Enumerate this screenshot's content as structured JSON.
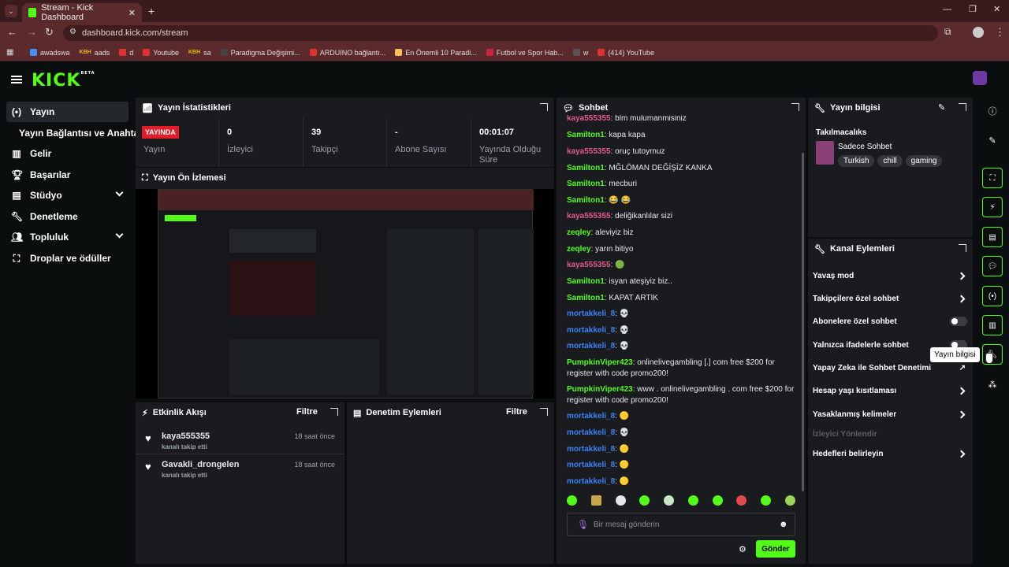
{
  "browser": {
    "tab_title": "Stream - Kick Dashboard",
    "url": "dashboard.kick.com/stream",
    "bookmarks": [
      {
        "label": "awadswa",
        "color": "#4a8df6"
      },
      {
        "label": "aads",
        "color": "#e9b800"
      },
      {
        "label": "d",
        "color": "#e03131"
      },
      {
        "label": "Youtube",
        "color": "#e03131"
      },
      {
        "label": "sa",
        "color": "#e9b800"
      },
      {
        "label": "Paradigma Değişimi...",
        "color": "#444"
      },
      {
        "label": "ARDUINO bağlantı...",
        "color": "#e03131"
      },
      {
        "label": "En Önemli 10 Paradi...",
        "color": "#f4c15a"
      },
      {
        "label": "Futbol ve Spor Hab...",
        "color": "#c24"
      },
      {
        "label": "w",
        "color": "#555"
      },
      {
        "label": "(414) YouTube",
        "color": "#e03131"
      }
    ],
    "bookmark_prefix": "KBH"
  },
  "brand": {
    "logo": "KICK",
    "beta": "BETA",
    "accent": "#53fc18"
  },
  "sidebar": {
    "items": [
      {
        "label": "Yayın",
        "icon": "broadcast-icon"
      },
      {
        "label": "Yayın Bağlantısı ve Anahtarı",
        "icon": ""
      },
      {
        "label": "Gelir",
        "icon": "revenue-icon"
      },
      {
        "label": "Başarılar",
        "icon": "trophy-icon"
      },
      {
        "label": "Stüdyo",
        "icon": "studio-icon"
      },
      {
        "label": "Denetleme",
        "icon": "wrench-icon"
      },
      {
        "label": "Topluluk",
        "icon": "community-icon"
      },
      {
        "label": "Droplar ve ödüller",
        "icon": "gift-icon"
      }
    ]
  },
  "stats": {
    "title": "Yayın İstatistikleri",
    "live_badge": "YAYINDA",
    "live_label": "Yayın",
    "viewers_value": "0",
    "viewers_label": "İzleyici",
    "followers_value": "39",
    "followers_label": "Takipçi",
    "subs_value": "-",
    "subs_label": "Abone Sayısı",
    "uptime_value": "00:01:07",
    "uptime_label": "Yayında Olduğu Süre"
  },
  "preview": {
    "title": "Yayın Ön İzlemesi"
  },
  "activity": {
    "title": "Etkinlik Akışı",
    "filter": "Filtre",
    "items": [
      {
        "user": "kaya555355",
        "action": "kanalı takip etti",
        "time": "18 saat önce"
      },
      {
        "user": "Gavakli_drongelen",
        "action": "kanalı takip etti",
        "time": "18 saat önce"
      }
    ]
  },
  "moderation": {
    "title": "Denetim Eylemleri",
    "filter": "Filtre"
  },
  "chat": {
    "title": "Sohbet",
    "messages": [
      {
        "user": "kaya555355",
        "color": "p",
        "text": ": blm mulumanmisiniz"
      },
      {
        "user": "Samilton1",
        "color": "g",
        "text": ": kapa kapa"
      },
      {
        "user": "kaya555355",
        "color": "p",
        "text": ": oruç tutoyrnuz"
      },
      {
        "user": "Samilton1",
        "color": "g",
        "text": ": MĞLÖMAN DEĞİŞİZ KANKA"
      },
      {
        "user": "Samilton1",
        "color": "g",
        "text": ": mecburi"
      },
      {
        "user": "Samilton1",
        "color": "g",
        "text": ": 😂 😂"
      },
      {
        "user": "kaya555355",
        "color": "p",
        "text": ": deliğikanlılar sizi"
      },
      {
        "user": "zeqley",
        "color": "g",
        "text": ": aleviyiz biz"
      },
      {
        "user": "zeqley",
        "color": "g",
        "text": ": yarın bitiyo"
      },
      {
        "user": "kaya555355",
        "color": "p",
        "text": ": 🟢"
      },
      {
        "user": "Samilton1",
        "color": "g",
        "text": ": isyan ateşiyiz biz.."
      },
      {
        "user": "Samilton1",
        "color": "g",
        "text": ": KAPAT ARTIK"
      },
      {
        "user": "mortakkeli_8",
        "color": "b",
        "text": ": 💀"
      },
      {
        "user": "mortakkeli_8",
        "color": "b",
        "text": ": 💀"
      },
      {
        "user": "mortakkeli_8",
        "color": "b",
        "text": ": 💀"
      },
      {
        "user": "PumpkinViper423",
        "color": "g",
        "text": ": onlinelivegambling [.] com free $200 for register with code promo200!"
      },
      {
        "user": "PumpkinViper423",
        "color": "g",
        "text": ": www . onlinelivegambling . com free $200 for register with code promo200!"
      },
      {
        "user": "mortakkeli_8",
        "color": "b",
        "text": ": 🟡"
      },
      {
        "user": "mortakkeli_8",
        "color": "b",
        "text": ": 💀"
      },
      {
        "user": "mortakkeli_8",
        "color": "b",
        "text": ": 🟡"
      },
      {
        "user": "mortakkeli_8",
        "color": "b",
        "text": ": 🟡"
      },
      {
        "user": "mortakkeli_8",
        "color": "b",
        "text": ": 🟡"
      }
    ],
    "placeholder": "Bir mesaj gönderin",
    "send": "Gönder"
  },
  "stream_info": {
    "title": "Yayın bilgisi",
    "category_label": "Takılmacalıks",
    "category": "Sadece Sohbet",
    "tags": [
      "Turkish",
      "chill",
      "gaming"
    ]
  },
  "channel_actions": {
    "title": "Kanal Eylemleri",
    "items": [
      {
        "label": "Yavaş mod",
        "control": "chevron"
      },
      {
        "label": "Takipçilere özel sohbet",
        "control": "chevron"
      },
      {
        "label": "Abonelere özel sohbet",
        "control": "toggle"
      },
      {
        "label": "Yalnızca ifadelerle sohbet",
        "control": "toggle"
      },
      {
        "label": "Yapay Zeka ile Sohbet Denetimi",
        "control": "external"
      },
      {
        "label": "Hesap yaşı kısıtlaması",
        "control": "chevron"
      },
      {
        "label": "Yasaklanmış kelimeler",
        "control": "chevron"
      },
      {
        "label": "İzleyici Yönlendir",
        "control": "disabled"
      },
      {
        "label": "Hedefleri belirleyin",
        "control": "chevron"
      }
    ]
  },
  "tooltip": "Yayın bilgisi"
}
